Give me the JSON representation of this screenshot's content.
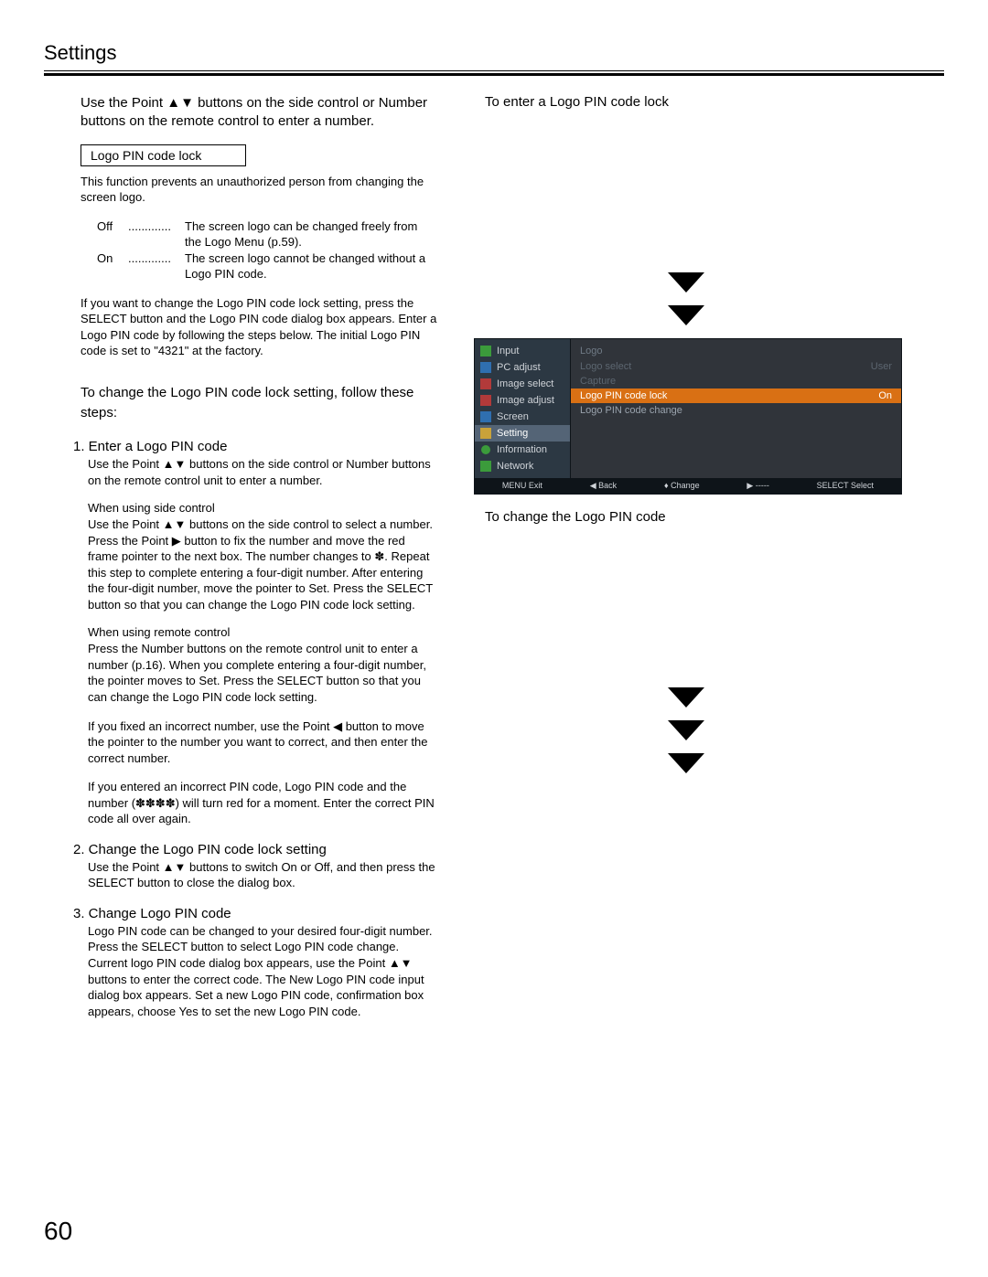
{
  "page": {
    "section": "Settings",
    "number": "60"
  },
  "intro": "Use the Point ▲▼ buttons on the side control or Number buttons on the remote control to enter a number.",
  "lockbox": {
    "title": "Logo PIN code lock",
    "desc": "This function prevents an unauthorized person from changing the screen logo.",
    "off_label": "Off",
    "off_dots": ".............",
    "off_text": "The screen logo can be changed freely from the Logo Menu (p.59).",
    "on_label": "On",
    "on_dots": ".............",
    "on_text": "The screen logo cannot be changed without a Logo PIN code.",
    "after": "If you want to change the Logo PIN code lock setting, press the SELECT button and the Logo PIN code dialog box appears. Enter a Logo PIN code by following the steps below. The initial Logo PIN code is set to \"4321\" at the factory."
  },
  "change_intro": "To change the Logo PIN code lock setting, follow these steps:",
  "step1": {
    "head": "1.  Enter a Logo PIN code",
    "body": "Use the Point ▲▼ buttons on the side control or Number buttons on the remote control unit to enter a number.",
    "side_head": "When using side control",
    "side_body": "Use the Point ▲▼ buttons on the side control to select a number. Press the Point ▶ button to fix the number and move the red frame pointer to the next box. The number changes to ✽. Repeat this step to complete entering a four-digit number. After entering the four-digit number, move the pointer to Set. Press the SELECT button so that you can change the Logo PIN code lock setting.",
    "remote_head": "When using remote control",
    "remote_body": "Press the Number buttons on the remote control unit to enter a number (p.16). When you complete entering a four-digit number, the pointer moves to Set. Press the SELECT button so that you can change the Logo PIN code lock setting.",
    "fix_body": "If you fixed an incorrect number, use the Point ◀ button to move the pointer to the number you want to correct, and then enter the correct number.",
    "wrong_body": "If you entered an incorrect PIN code, Logo PIN code and the number (✽✽✽✽) will turn red for a moment. Enter the correct PIN code all over again."
  },
  "step2": {
    "head": "2.  Change the Logo PIN code lock setting",
    "body": "Use the Point ▲▼ buttons to switch On or Off, and then press the SELECT button to close the dialog box."
  },
  "step3": {
    "head": "3.  Change Logo PIN code",
    "body": "Logo PIN code can be changed to your desired four-digit number. Press the SELECT button to select Logo PIN code change. Current logo PIN code dialog box appears, use the Point ▲▼ buttons to enter the correct code. The New Logo PIN code input dialog box appears. Set a new Logo PIN code, confirmation box appears, choose Yes to set the new Logo PIN code."
  },
  "right": {
    "enter_title": "To enter a Logo PIN code lock",
    "change_title": "To change the Logo PIN code"
  },
  "menu": {
    "left": {
      "input": "Input",
      "pc": "PC adjust",
      "imgsel": "Image select",
      "imgadj": "Image adjust",
      "screen": "Screen",
      "setting": "Setting",
      "info": "Information",
      "network": "Network"
    },
    "right_head_l": "Logo",
    "right_head_r": "",
    "items": [
      {
        "l": "Logo select",
        "r": "User",
        "cls": "dim"
      },
      {
        "l": "Capture",
        "r": "",
        "cls": "dim"
      },
      {
        "l": "Logo PIN code lock",
        "r": "On",
        "cls": "hot"
      },
      {
        "l": "Logo PIN code change",
        "r": "",
        "cls": ""
      }
    ],
    "footer": {
      "exit": "MENU Exit",
      "back": "◀ Back",
      "change": "♦ Change",
      "dash": "▶ -----",
      "select": "SELECT Select"
    }
  }
}
